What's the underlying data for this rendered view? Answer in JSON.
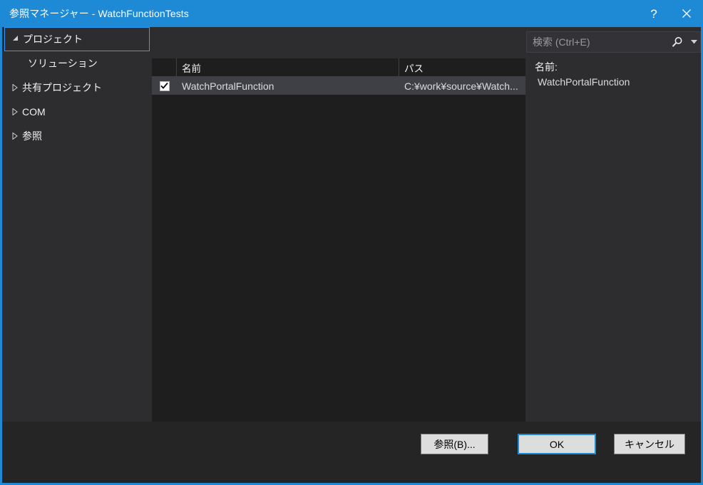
{
  "window": {
    "title": "参照マネージャー - WatchFunctionTests",
    "help_label": "?",
    "close_label": "✕",
    "accent_color": "#1e8ad6",
    "background_color": "#2d2d30"
  },
  "sidebar": {
    "items": [
      {
        "label": "プロジェクト",
        "expander": "expanded",
        "level": 0,
        "selected": true
      },
      {
        "label": "ソリューション",
        "expander": "none",
        "level": 1,
        "selected": false
      },
      {
        "label": "共有プロジェクト",
        "expander": "collapsed",
        "level": 0,
        "selected": false
      },
      {
        "label": "COM",
        "expander": "collapsed",
        "level": 0,
        "selected": false
      },
      {
        "label": "参照",
        "expander": "collapsed",
        "level": 0,
        "selected": false
      }
    ]
  },
  "search": {
    "value": "",
    "placeholder": "検索 (Ctrl+E)",
    "icon": "search-icon",
    "dropdown_icon": "chevron-down-icon"
  },
  "list": {
    "columns": [
      "",
      "名前",
      "パス"
    ],
    "rows": [
      {
        "checked": true,
        "name": "WatchPortalFunction",
        "path": "C:¥work¥source¥Watch...",
        "selected": true
      }
    ]
  },
  "details": {
    "label": "名前:",
    "value": "WatchPortalFunction"
  },
  "footer": {
    "browse_label": "参照(B)...",
    "ok_label": "OK",
    "cancel_label": "キャンセル"
  }
}
